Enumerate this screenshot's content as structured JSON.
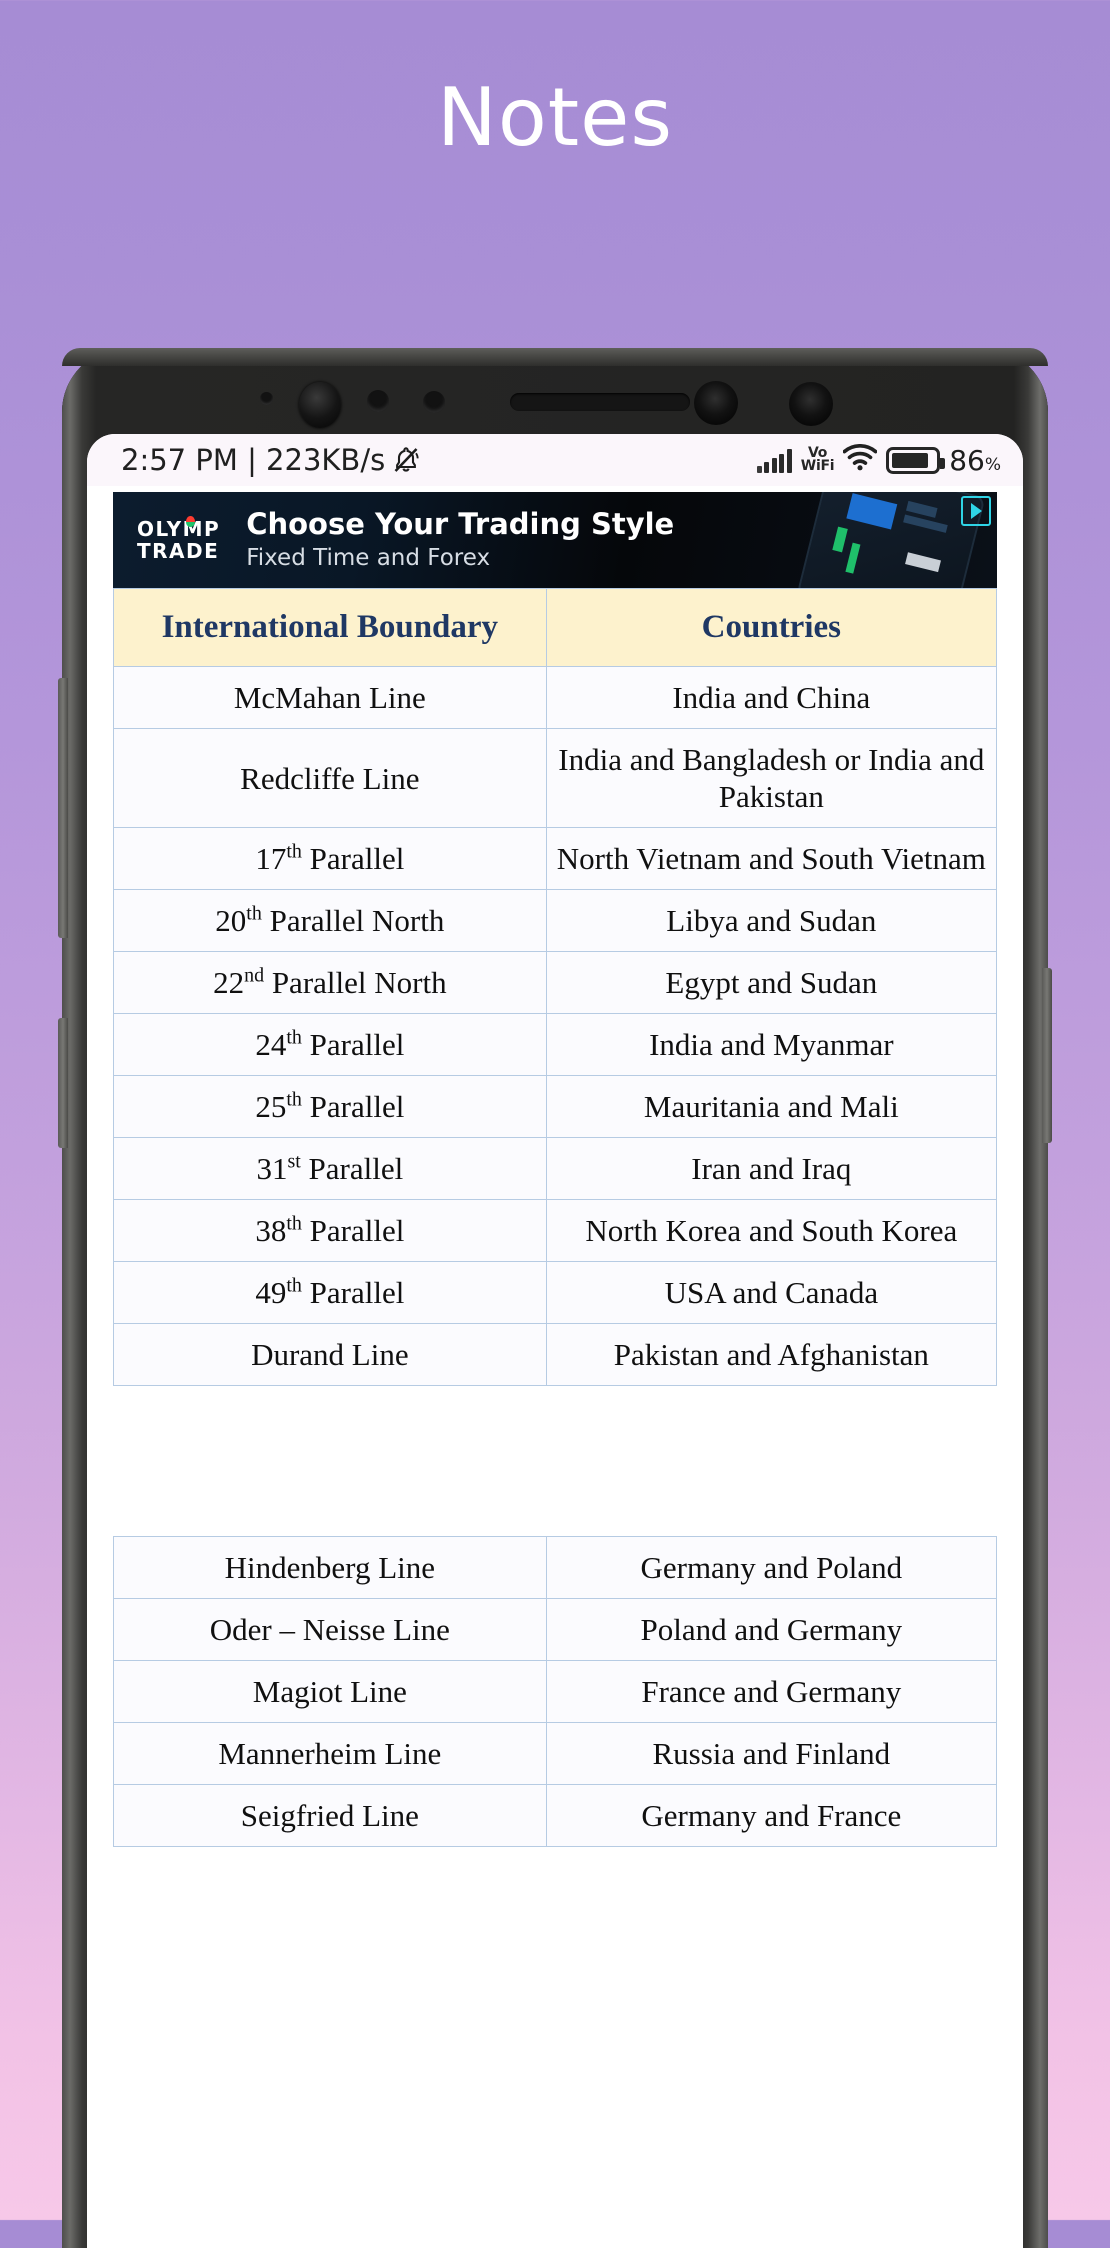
{
  "page": {
    "title": "Notes",
    "title_color": "#ffffff",
    "background_top_color": "#a68cd4",
    "background_bottom_color": "#f7c8e8"
  },
  "status_bar": {
    "time_and_speed": "2:57 PM | 223KB/s",
    "mute_icon": "bell-muted-icon",
    "signal_icon": "cellular-signal-icon",
    "volte_label_line1": "Vo",
    "volte_label_line2": "WiFi",
    "wifi_icon": "wifi-icon",
    "battery_icon": "battery-icon",
    "battery_level": "86",
    "battery_percent_symbol": "%"
  },
  "ad": {
    "brand_line1": "OLYMP",
    "brand_line2": "TRADE",
    "headline": "Choose Your Trading Style",
    "subline": "Fixed Time and Forex",
    "adchoices_icon": "adchoices-triangle-icon"
  },
  "table": {
    "headers": [
      "International Boundary",
      "Countries"
    ],
    "header_bg": "#fdf2cd",
    "header_text_color": "#1f3864",
    "border_color": "#b6cbe3",
    "rows": [
      {
        "boundary": "McMahan Line",
        "sup": "",
        "countries": "India and China"
      },
      {
        "boundary": "Redcliffe Line",
        "sup": "",
        "countries": "India and Bangladesh or India and Pakistan"
      },
      {
        "boundary": "17 Parallel",
        "sup": "th",
        "countries": "North Vietnam and South Vietnam"
      },
      {
        "boundary": "20 Parallel North",
        "sup": "th",
        "countries": "Libya and Sudan"
      },
      {
        "boundary": "22 Parallel North",
        "sup": "nd",
        "countries": "Egypt and Sudan"
      },
      {
        "boundary": "24 Parallel",
        "sup": "th",
        "countries": "India and Myanmar"
      },
      {
        "boundary": "25 Parallel",
        "sup": "th",
        "countries": "Mauritania and Mali"
      },
      {
        "boundary": "31 Parallel",
        "sup": "st",
        "countries": "Iran and Iraq"
      },
      {
        "boundary": "38 Parallel",
        "sup": "th",
        "countries": "North Korea and South Korea"
      },
      {
        "boundary": "49 Parallel",
        "sup": "th",
        "countries": "USA and Canada"
      },
      {
        "boundary": "Durand Line",
        "sup": "",
        "countries": "Pakistan and Afghanistan"
      }
    ]
  },
  "table2": {
    "border_color": "#b6cbe3",
    "rows": [
      {
        "boundary": "Hindenberg Line",
        "countries": "Germany and Poland"
      },
      {
        "boundary": "Oder – Neisse Line",
        "countries": "Poland and Germany"
      },
      {
        "boundary": "Magiot Line",
        "countries": "France and Germany"
      },
      {
        "boundary": "Mannerheim Line",
        "countries": "Russia and Finland"
      },
      {
        "boundary": "Seigfried Line",
        "countries": "Germany and France"
      }
    ]
  }
}
